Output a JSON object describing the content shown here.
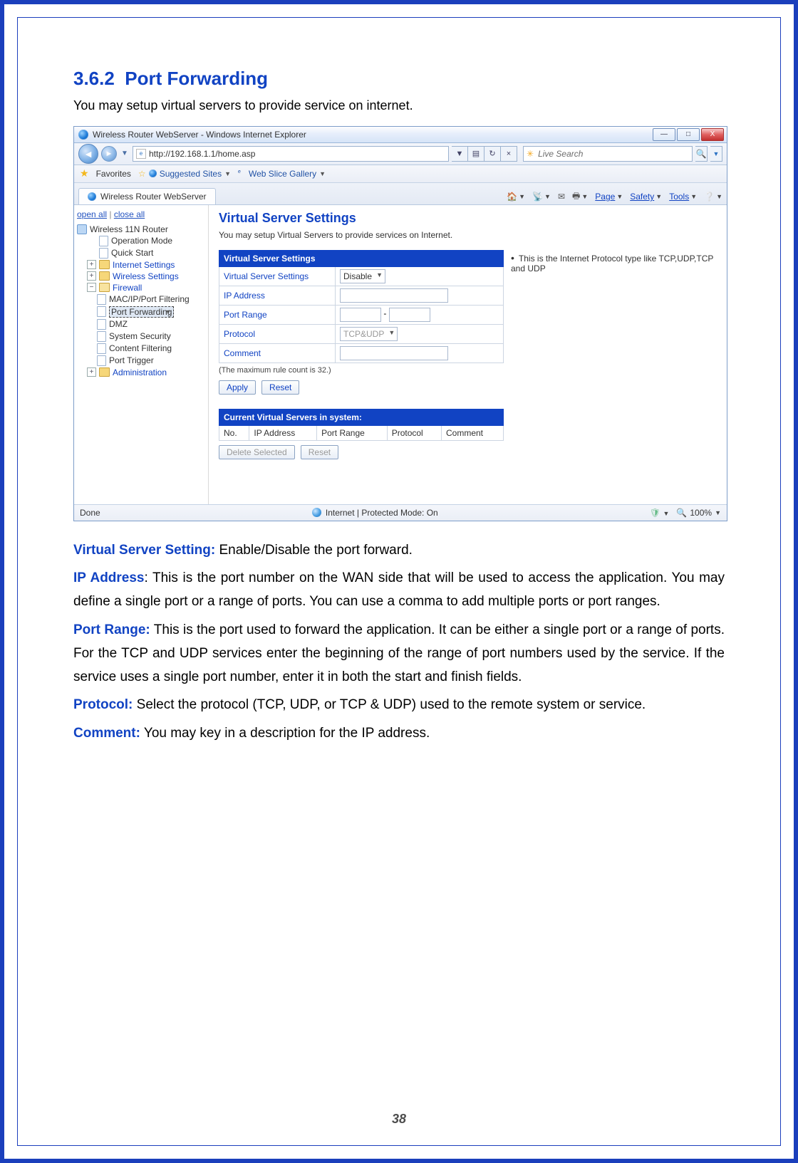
{
  "section_number": "3.6.2",
  "section_title": "Port Forwarding",
  "intro_line": "You may setup virtual servers to provide service on internet.",
  "page_number": "38",
  "shot": {
    "title": "Wireless Router WebServer - Windows Internet Explorer",
    "win_min": "—",
    "win_max": "□",
    "win_close": "X",
    "url": "http://192.168.1.1/home.asp",
    "refresh": "↻",
    "stop": "×",
    "search_placeholder": "Live Search",
    "search_icon": "🔍",
    "favorites_label": "Favorites",
    "suggested_sites": "Suggested Sites",
    "web_slice": "Web Slice Gallery",
    "tab_title": "Wireless Router WebServer",
    "menu_page": "Page",
    "menu_safety": "Safety",
    "menu_tools": "Tools",
    "status_done": "Done",
    "status_zone": "Internet | Protected Mode: On",
    "status_zoom": "100%"
  },
  "sidebar": {
    "open_all": "open all",
    "close_all": "close all",
    "root": "Wireless 11N Router",
    "items": [
      "Operation Mode",
      "Quick Start",
      "Internet Settings",
      "Wireless Settings",
      "Firewall",
      "Administration"
    ],
    "fw_children": [
      "MAC/IP/Port Filtering",
      "Port Forwarding",
      "DMZ",
      "System Security",
      "Content Filtering",
      "Port Trigger"
    ]
  },
  "vs": {
    "heading": "Virtual Server Settings",
    "desc": "You may setup Virtual Servers to provide services on Internet.",
    "panel_header": "Virtual Server Settings",
    "rows": {
      "vss_label": "Virtual Server Settings",
      "vss_value": "Disable",
      "ip_label": "IP Address",
      "port_label": "Port Range",
      "protocol_label": "Protocol",
      "protocol_value": "TCP&UDP",
      "comment_label": "Comment"
    },
    "max_note": "(The maximum rule count is 32.)",
    "apply": "Apply",
    "reset": "Reset",
    "side_note": "This is the Internet Protocol type like TCP,UDP,TCP and UDP",
    "list_header": "Current Virtual Servers in system:",
    "cols": {
      "no": "No.",
      "ip": "IP Address",
      "port": "Port Range",
      "proto": "Protocol",
      "comment": "Comment"
    },
    "delete_selected": "Delete Selected",
    "reset2": "Reset"
  },
  "defs": {
    "vss_term": "Virtual Server Setting:",
    "vss_text": " Enable/Disable the port forward.",
    "ip_term": "IP Address",
    "ip_text": ": This is the port number on the WAN side that will be used to access the application. You may define a single port or a range of ports. You can use a comma to add multiple ports or port ranges.",
    "port_term": "Port Range:",
    "port_text": " This is the port used to forward the application. It can be either a single port or a range of ports. For the TCP and UDP services enter the beginning of the range of port numbers used by the service. If the service uses a single port number, enter it in both the start and finish fields.",
    "proto_term": "Protocol:",
    "proto_text": " Select the protocol (TCP, UDP, or TCP & UDP) used to the remote system or service.",
    "comment_term": "Comment:",
    "comment_text": " You may key in a description for the IP address."
  }
}
